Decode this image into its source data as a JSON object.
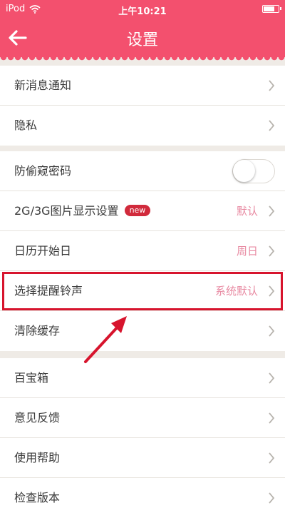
{
  "status_bar": {
    "carrier": "iPod",
    "time": "上午10:21"
  },
  "nav": {
    "title": "设置"
  },
  "groups": [
    [
      {
        "label": "新消息通知"
      },
      {
        "label": "隐私"
      }
    ],
    [
      {
        "label": "防偷窥密码",
        "toggle": "off"
      },
      {
        "label": "2G/3G图片显示设置",
        "badge": "new",
        "value": "默认"
      },
      {
        "label": "日历开始日",
        "value": "周日"
      },
      {
        "label": "选择提醒铃声",
        "value": "系统默认",
        "highlighted": true
      },
      {
        "label": "清除缓存"
      }
    ],
    [
      {
        "label": "百宝箱"
      },
      {
        "label": "意见反馈"
      },
      {
        "label": "使用帮助"
      },
      {
        "label": "检查版本"
      }
    ]
  ],
  "colors": {
    "header": "#f3506e",
    "value_text": "#e88aa2",
    "badge": "#d12a3c",
    "highlight": "#d7142d",
    "background": "#efebe6"
  },
  "icons": {
    "back": "arrow-left-icon",
    "row": "chevron-right-icon",
    "wifi": "wifi-icon",
    "battery": "battery-icon"
  }
}
